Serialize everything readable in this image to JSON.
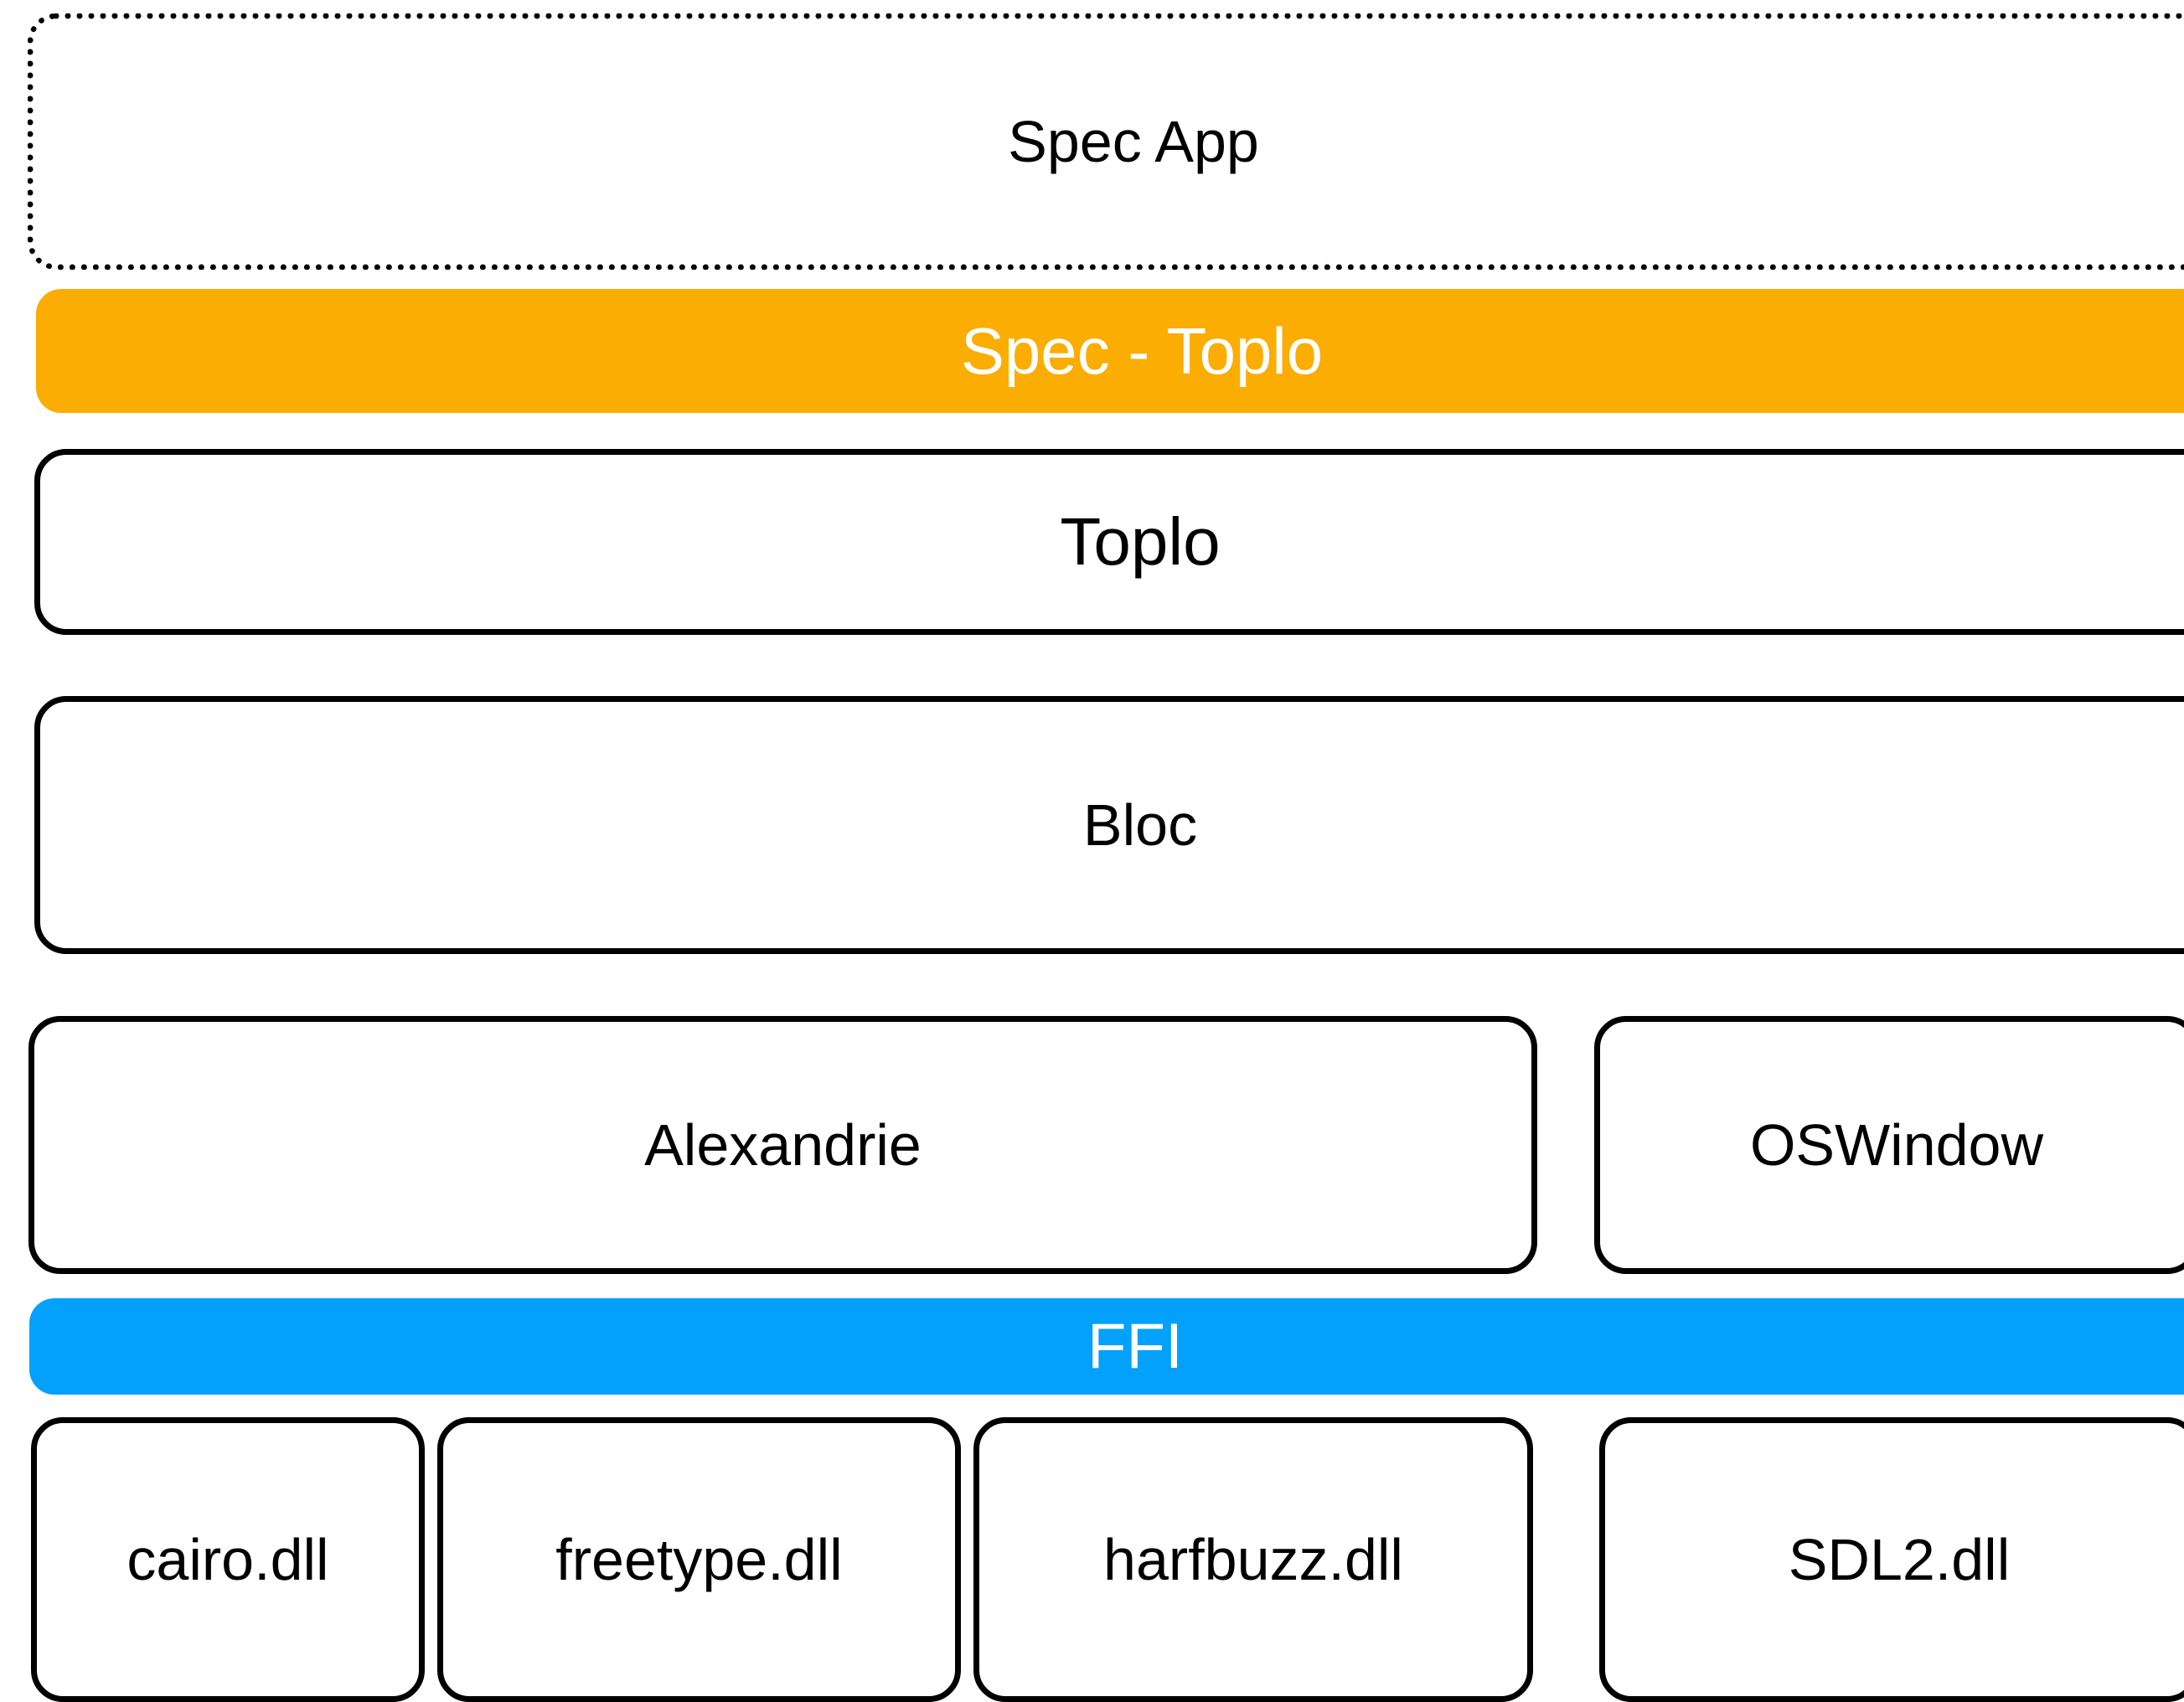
{
  "layers": {
    "spec_app": {
      "label": "Spec App"
    },
    "spec_toplo": {
      "label": "Spec - Toplo",
      "color": "#FBAD04"
    },
    "toplo": {
      "label": "Toplo"
    },
    "bloc": {
      "label": "Bloc"
    },
    "alexandrie": {
      "label": "Alexandrie"
    },
    "oswindow": {
      "label": "OSWindow"
    },
    "ffi": {
      "label": "FFI",
      "color": "#03A1FC"
    },
    "libraries": [
      {
        "label": "cairo.dll"
      },
      {
        "label": "freetype.dll"
      },
      {
        "label": "harfbuzz.dll"
      },
      {
        "label": "SDL2.dll"
      }
    ]
  }
}
